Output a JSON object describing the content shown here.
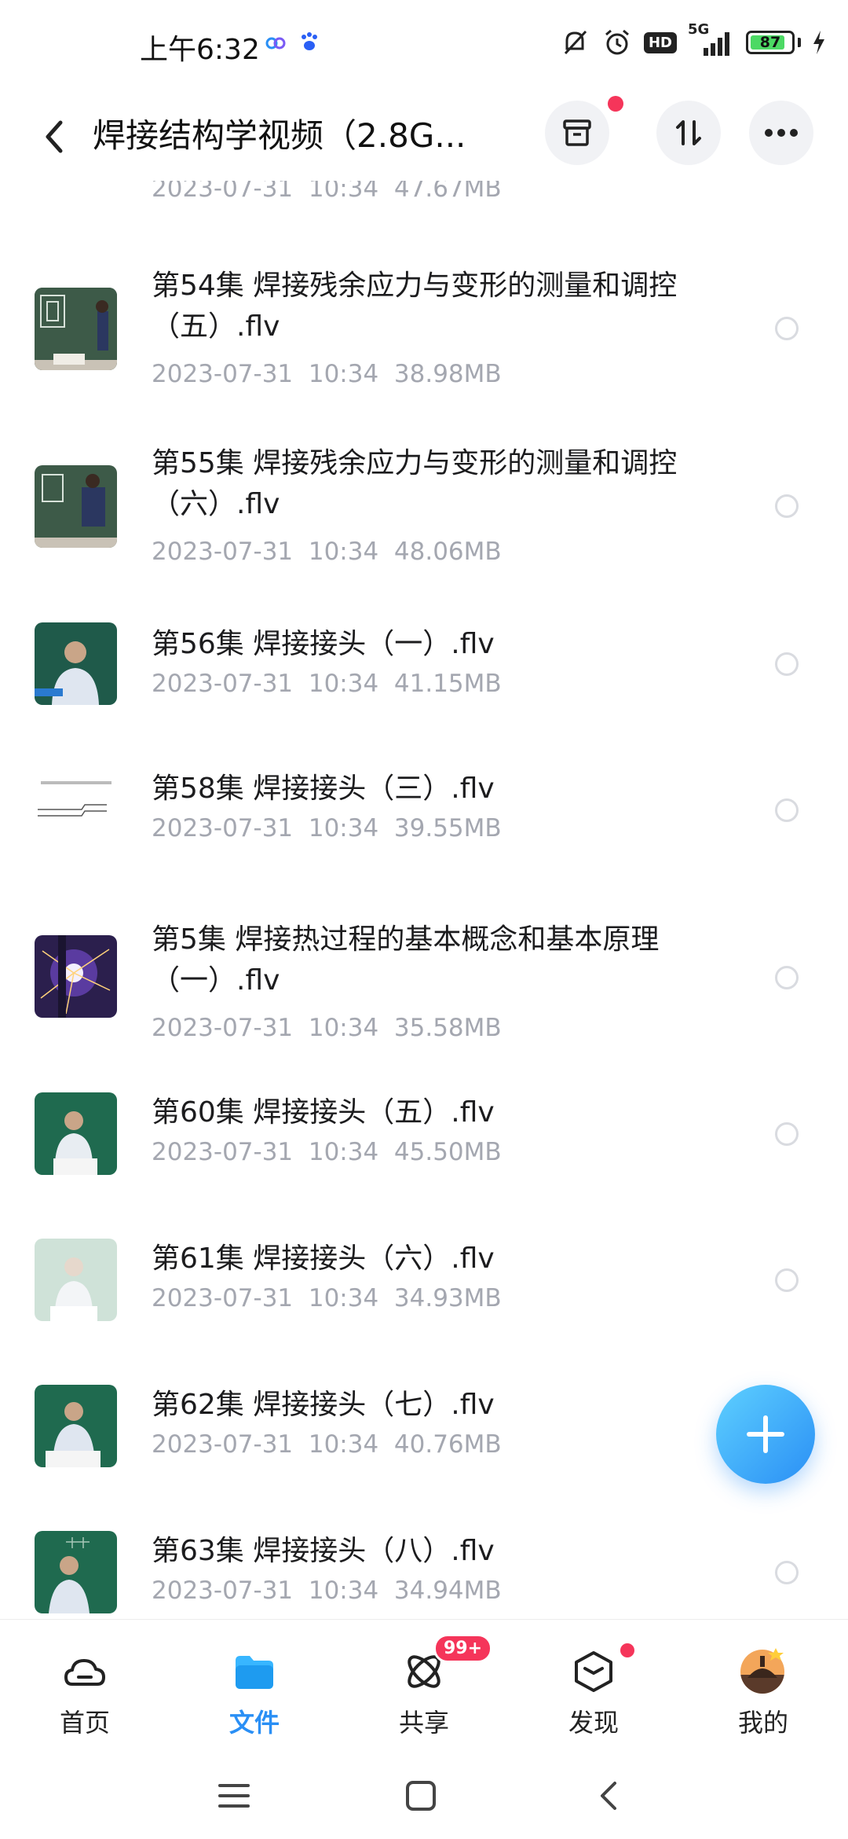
{
  "status_bar": {
    "time": "上午6:32",
    "hd": "HD",
    "network": "5G",
    "battery": 87,
    "battery_label": "87"
  },
  "header": {
    "title": "焊接结构学视频（2.8G..."
  },
  "files": [
    {
      "name": "",
      "meta": "2023-07-31  10:34  47.67MB"
    },
    {
      "name": "第54集 焊接残余应力与变形的测量和调控（五）.flv",
      "meta": "2023-07-31  10:34  38.98MB"
    },
    {
      "name": "第55集 焊接残余应力与变形的测量和调控（六）.flv",
      "meta": "2023-07-31  10:34  48.06MB"
    },
    {
      "name": "第56集 焊接接头（一）.flv",
      "meta": "2023-07-31  10:34  41.15MB"
    },
    {
      "name": "第58集 焊接接头（三）.flv",
      "meta": "2023-07-31  10:34  39.55MB"
    },
    {
      "name": "第5集 焊接热过程的基本概念和基本原理（一）.flv",
      "meta": "2023-07-31  10:34  35.58MB"
    },
    {
      "name": "第60集 焊接接头（五）.flv",
      "meta": "2023-07-31  10:34  45.50MB"
    },
    {
      "name": "第61集 焊接接头（六）.flv",
      "meta": "2023-07-31  10:34  34.93MB"
    },
    {
      "name": "第62集 焊接接头（七）.flv",
      "meta": "2023-07-31  10:34  40.76MB"
    },
    {
      "name": "第63集 焊接接头（八）.flv",
      "meta": "2023-07-31  10:34  34.94MB"
    }
  ],
  "bottom_nav": {
    "home": "首页",
    "files": "文件",
    "share": "共享",
    "share_badge": "99+",
    "discover": "发现",
    "mine": "我的"
  },
  "colors": {
    "accent": "#2a8ff5",
    "meta_text": "#a4a7b0",
    "badge": "#f5355a"
  }
}
